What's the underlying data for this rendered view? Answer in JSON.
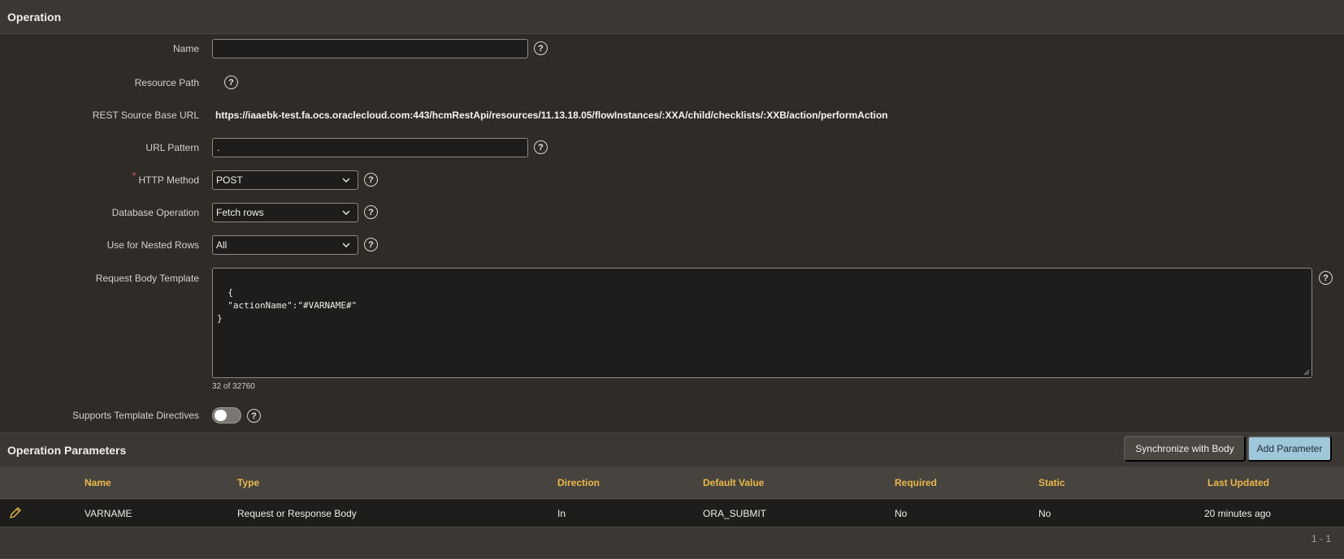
{
  "region": {
    "title": "Operation"
  },
  "fields": {
    "name": {
      "label": "Name",
      "value": "",
      "help": "?"
    },
    "resource_path": {
      "label": "Resource Path",
      "help": "?"
    },
    "base_url": {
      "label": "REST Source Base URL",
      "value": "https://iaaebk-test.fa.ocs.oraclecloud.com:443/hcmRestApi/resources/11.13.18.05/flowInstances/:XXA/child/checklists/:XXB/action/performAction"
    },
    "url_pattern": {
      "label": "URL Pattern",
      "value": ".",
      "help": "?"
    },
    "http_method": {
      "label": "HTTP Method",
      "required_mark": "*",
      "value": "POST",
      "help": "?"
    },
    "db_operation": {
      "label": "Database Operation",
      "value": "Fetch rows",
      "help": "?"
    },
    "nested_rows": {
      "label": "Use for Nested Rows",
      "value": "All",
      "help": "?"
    },
    "body_template": {
      "label": "Request Body Template",
      "value": "{\n  \"actionName\":\"#VARNAME#\"\n}",
      "counter": "32 of 32760",
      "help": "?"
    },
    "template_directives": {
      "label": "Supports Template Directives",
      "checked": false,
      "help": "?"
    }
  },
  "parameters": {
    "title": "Operation Parameters",
    "sync_button": "Synchronize with Body",
    "add_button": "Add Parameter",
    "columns": [
      "Name",
      "Type",
      "Direction",
      "Default Value",
      "Required",
      "Static",
      "Last Updated"
    ],
    "rows": [
      {
        "name": "VARNAME",
        "type": "Request or Response Body",
        "direction": "In",
        "default_value": "ORA_SUBMIT",
        "required": "No",
        "static": "No",
        "last_updated": "20 minutes ago"
      }
    ],
    "pagination": "1 - 1"
  },
  "icons": {
    "help": "help-icon",
    "edit": "pencil-icon",
    "select": "chevron-down-icon"
  },
  "colors": {
    "background": "#2f2c28",
    "header": "#3b3732",
    "column_header_text": "#e8b94a",
    "primary_button": "#9fc7da",
    "required": "#e0505a"
  }
}
